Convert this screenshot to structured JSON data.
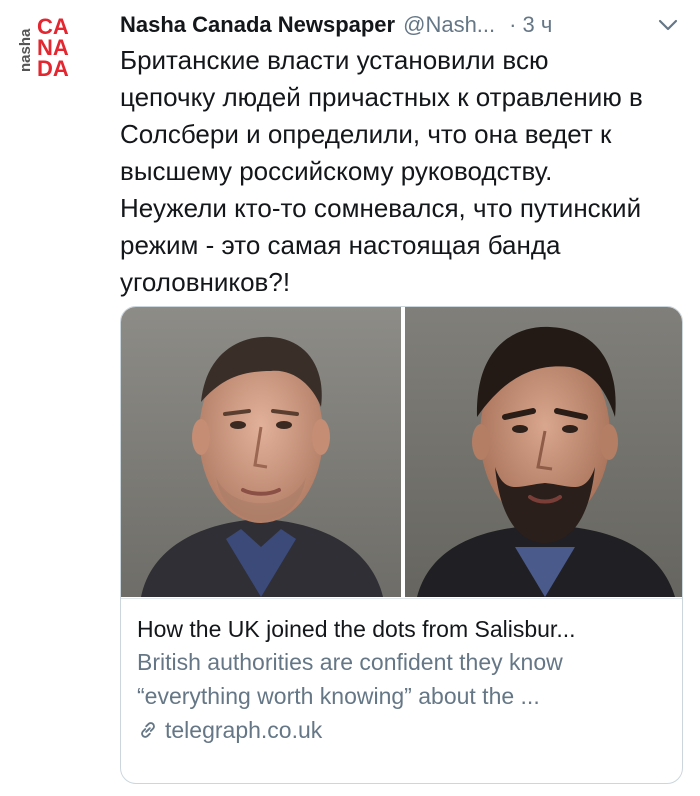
{
  "tweet": {
    "author_name": "Nasha Canada Newspaper",
    "handle": "@Nash...",
    "separator": "·",
    "time": "3 ч",
    "avatar_logo": {
      "prefix": "nasha",
      "lines": [
        "CA",
        "NA",
        "DA"
      ],
      "accent_color": "#e3262f"
    },
    "text_lines": [
      "Британские власти установили всю",
      "цепочку людей причастных к отравлению в",
      "Солсбери и определили, что она ведет к",
      "высшему российскому руководству.",
      "Неужели кто-то сомневался, что путинский",
      "режим - это самая настоящая банда",
      "уголовников?!"
    ],
    "card": {
      "title": "How the UK joined the dots from Salisbur...",
      "description_lines": [
        "British authorities are confident they know",
        "“everything worth knowing” about the ..."
      ],
      "domain": "telegraph.co.uk",
      "link_icon": "link-icon"
    }
  },
  "colors": {
    "text": "#14171a",
    "secondary": "#657786",
    "border": "#ccd6dd"
  }
}
